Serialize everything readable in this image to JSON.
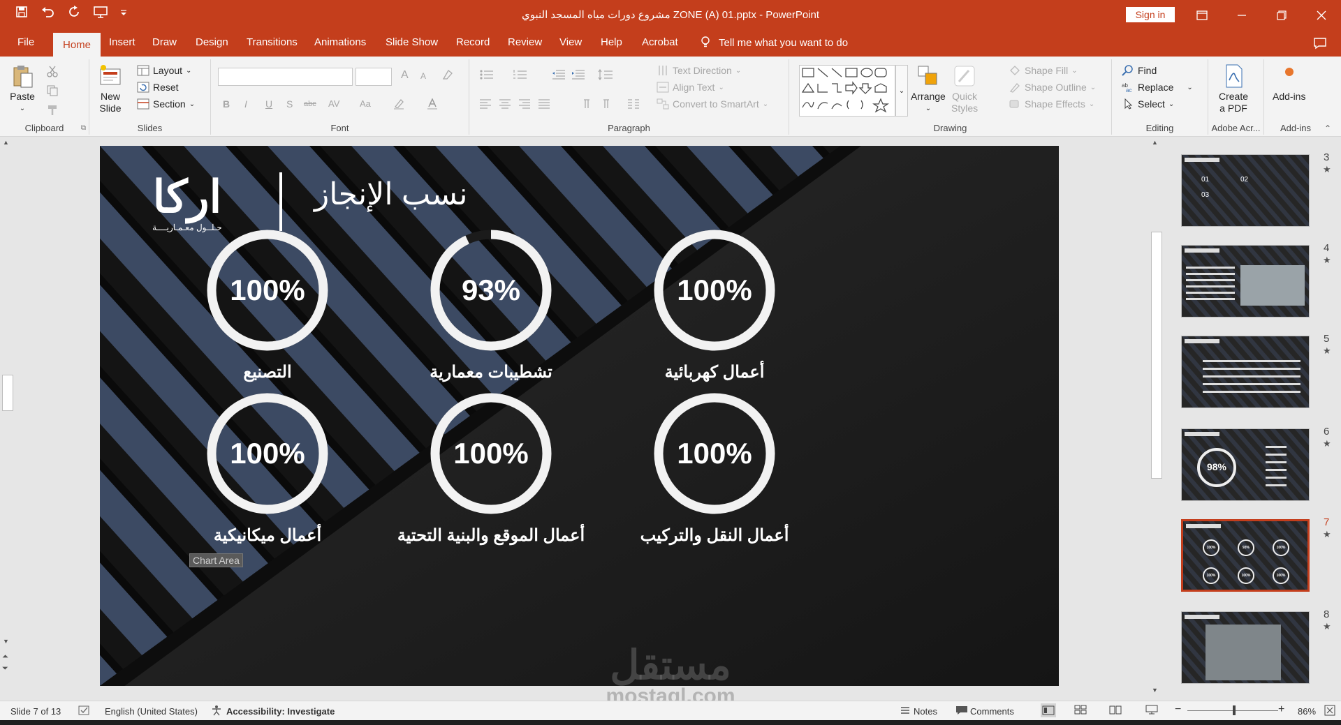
{
  "window": {
    "title": "مشروع دورات مياه المسجد النبوي ZONE (A) 01.pptx  -  PowerPoint",
    "sign_in": "Sign in"
  },
  "tabs": {
    "file": "File",
    "home": "Home",
    "insert": "Insert",
    "draw": "Draw",
    "design": "Design",
    "transitions": "Transitions",
    "animations": "Animations",
    "slideshow": "Slide Show",
    "record": "Record",
    "review": "Review",
    "view": "View",
    "help": "Help",
    "acrobat": "Acrobat",
    "tell_me": "Tell me what you want to do"
  },
  "ribbon": {
    "clipboard": {
      "label": "Clipboard",
      "paste": "Paste"
    },
    "slides": {
      "label": "Slides",
      "new_slide_1": "New",
      "new_slide_2": "Slide",
      "layout": "Layout",
      "reset": "Reset",
      "section": "Section"
    },
    "font": {
      "label": "Font",
      "bold": "B",
      "italic": "I",
      "underline": "U",
      "strike": "S",
      "abc": "abc",
      "av": "AV",
      "aa": "Aa",
      "grow": "A",
      "shrink": "A"
    },
    "paragraph": {
      "label": "Paragraph",
      "text_direction": "Text Direction",
      "align_text": "Align Text",
      "smartart": "Convert to SmartArt"
    },
    "drawing": {
      "label": "Drawing",
      "arrange": "Arrange",
      "quick_styles_1": "Quick",
      "quick_styles_2": "Styles",
      "shape_fill": "Shape Fill",
      "shape_outline": "Shape Outline",
      "shape_effects": "Shape Effects"
    },
    "editing": {
      "label": "Editing",
      "find": "Find",
      "replace": "Replace",
      "select": "Select"
    },
    "adobe": {
      "label": "Adobe Acr...",
      "create_1": "Create",
      "create_2": "a PDF"
    },
    "addins": {
      "label": "Add-ins",
      "addins": "Add-ins"
    }
  },
  "slide": {
    "title": "نسب الإنجاز",
    "logo_word": "اركا",
    "logo_tagline": "حـلــول    معـمـاريــــة",
    "tooltip": "Chart Area",
    "gauges": [
      {
        "value": "100%",
        "fraction": 1.0,
        "label": "التصنيع"
      },
      {
        "value": "93%",
        "fraction": 0.93,
        "label": "تشطيبات معمارية"
      },
      {
        "value": "100%",
        "fraction": 1.0,
        "label": "أعمال كهربائية"
      },
      {
        "value": "100%",
        "fraction": 1.0,
        "label": "أعمال ميكانيكية"
      },
      {
        "value": "100%",
        "fraction": 1.0,
        "label": "أعمال الموقع والبنية التحتية"
      },
      {
        "value": "100%",
        "fraction": 1.0,
        "label": "أعمال النقل والتركيب"
      }
    ]
  },
  "thumbnails": [
    {
      "num": "3",
      "star": "★",
      "items": [
        "01",
        "02",
        "03"
      ]
    },
    {
      "num": "4",
      "star": "★"
    },
    {
      "num": "5",
      "star": "★"
    },
    {
      "num": "6",
      "star": "★",
      "gauge": "98%"
    },
    {
      "num": "7",
      "star": "★",
      "selected": true,
      "mini": [
        "100%",
        "93%",
        "100%",
        "100%",
        "100%",
        "100%"
      ]
    },
    {
      "num": "8",
      "star": "★"
    }
  ],
  "statusbar": {
    "slide_of": "Slide 7 of 13",
    "language": "English (United States)",
    "accessibility": "Accessibility: Investigate",
    "notes": "Notes",
    "comments": "Comments",
    "zoom": "86%"
  },
  "watermark": {
    "ar": "مستقل",
    "en": "mostaql.com"
  },
  "colors": {
    "accent": "#c43e1c",
    "ribbon": "#f3f3f3",
    "slide_bg": "#1e1e1e",
    "stripe": "#3c4a63"
  }
}
